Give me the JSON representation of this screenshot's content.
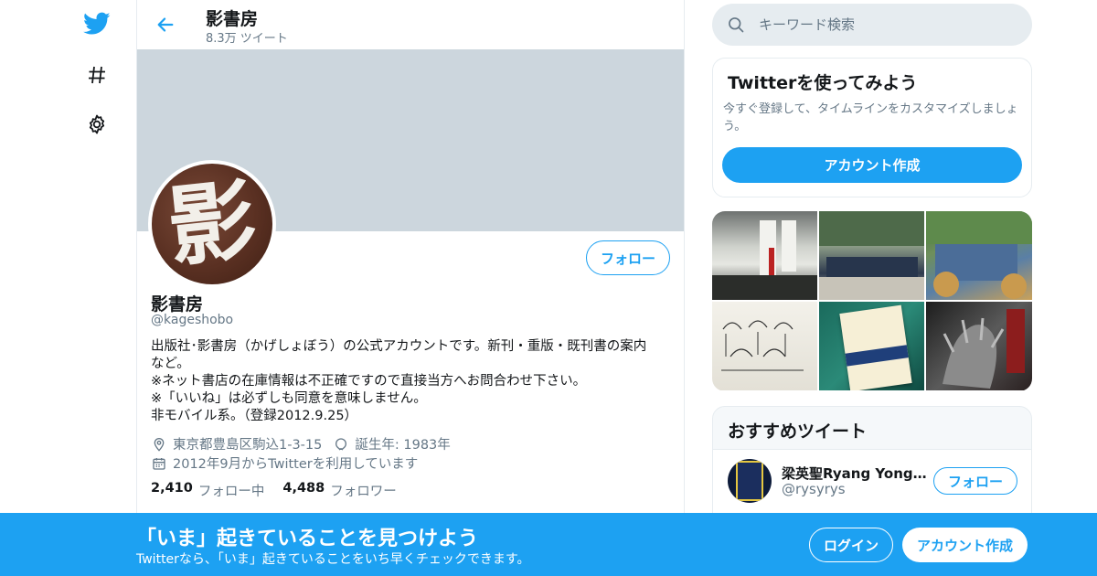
{
  "nav": {
    "items": [
      {
        "icon": "twitter-bird-icon"
      },
      {
        "icon": "hashtag-icon"
      },
      {
        "icon": "gear-icon"
      }
    ]
  },
  "header": {
    "title": "影書房",
    "subtitle": "8.3万 ツイート"
  },
  "profile": {
    "avatar_glyph": "影",
    "follow_label": "フォロー",
    "name": "影書房",
    "handle": "@kageshobo",
    "bio": [
      "出版社･影書房（かげしょぼう）の公式アカウントです。新刊・重版・既刊書の案内",
      "など。",
      "※ネット書店の在庫情報は不正確ですので直接当方へお問合わせ下さい。",
      "※「いいね」は必ずしも同意を意味しません。",
      "非モバイル系。（登録2012.9.25）"
    ],
    "location": "東京都豊島区駒込1-3-15",
    "birthday": "誕生年: 1983年",
    "joined": "2012年9月からTwitterを利用しています",
    "following_count": "2,410",
    "following_label": "フォロー中",
    "followers_count": "4,488",
    "followers_label": "フォロワー"
  },
  "search": {
    "placeholder": "キーワード検索"
  },
  "signup_card": {
    "title": "Twitterを使ってみよう",
    "description": "今すぐ登録して、タイムラインをカスタマイズしましょう。",
    "button": "アカウント作成"
  },
  "recommended": {
    "title": "おすすめツイート",
    "users": [
      {
        "name": "梁英聖Ryang Yong-S...",
        "handle": "@rysyrys",
        "follow_label": "フォロー"
      }
    ]
  },
  "bottom_bar": {
    "title": "「いま」起きていることを見つけよう",
    "subtitle": "Twitterなら、「いま」起きていることをいち早くチェックできます。",
    "login": "ログイン",
    "signup": "アカウント作成"
  },
  "colors": {
    "accent": "#1da1f2",
    "banner": "#ccd6dd",
    "muted": "#657786"
  }
}
